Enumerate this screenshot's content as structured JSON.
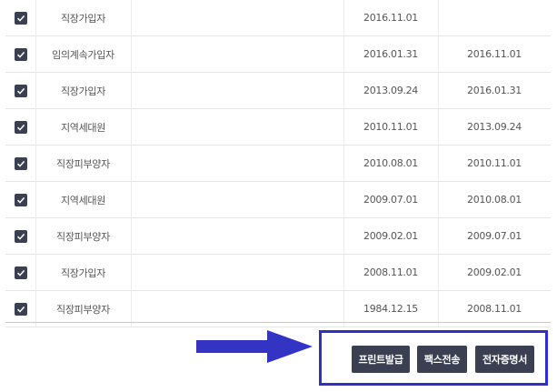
{
  "rows": [
    {
      "type": "직장가입자",
      "start": "2016.11.01",
      "end": ""
    },
    {
      "type": "임의계속가입자",
      "start": "2016.01.31",
      "end": "2016.11.01"
    },
    {
      "type": "직장가입자",
      "start": "2013.09.24",
      "end": "2016.01.31"
    },
    {
      "type": "지역세대원",
      "start": "2010.11.01",
      "end": "2013.09.24"
    },
    {
      "type": "직장피부양자",
      "start": "2010.08.01",
      "end": "2010.11.01"
    },
    {
      "type": "지역세대원",
      "start": "2009.07.01",
      "end": "2010.08.01"
    },
    {
      "type": "직장피부양자",
      "start": "2009.02.01",
      "end": "2009.07.01"
    },
    {
      "type": "직장가입자",
      "start": "2008.11.01",
      "end": "2009.02.01"
    },
    {
      "type": "직장피부양자",
      "start": "1984.12.15",
      "end": "2008.11.01"
    }
  ],
  "actions": {
    "print_label": "프린트발급",
    "fax_label": "팩스전송",
    "ecert_label": "전자증명서"
  },
  "colors": {
    "accent": "#2f2fc6",
    "button": "#3a3f52"
  }
}
